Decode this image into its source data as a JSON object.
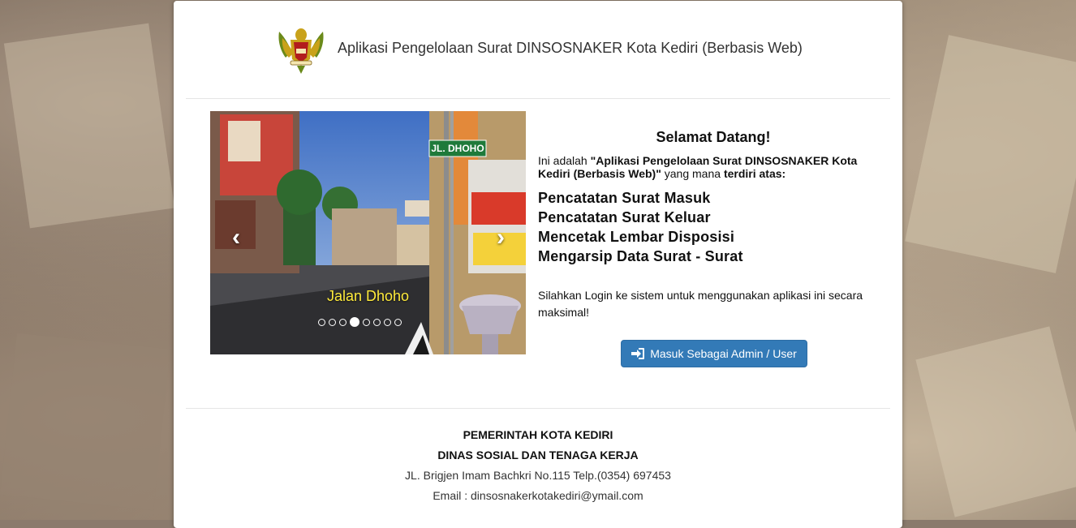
{
  "header": {
    "title": "Aplikasi Pengelolaan Surat DINSOSNAKER Kota Kediri (Berbasis Web)"
  },
  "carousel": {
    "sign_text": "JL. DHOHO",
    "caption": "Jalan Dhoho",
    "slide_count": 8,
    "active_index": 3,
    "prev_icon": "chevron-left-icon",
    "next_icon": "chevron-right-icon"
  },
  "welcome": {
    "heading": "Selamat Datang!",
    "intro_prefix": "Ini adalah ",
    "intro_app": "\"Aplikasi Pengelolaan Surat DINSOSNAKER Kota Kediri (Berbasis Web)\"",
    "intro_mid": " yang mana ",
    "intro_suffix": "terdiri atas:",
    "features": [
      "Pencatatan Surat Masuk",
      "Pencatatan Surat Keluar",
      "Mencetak Lembar Disposisi",
      "Mengarsip Data Surat - Surat"
    ],
    "login_text": "Silahkan Login ke sistem untuk menggunakan aplikasi ini secara maksimal!"
  },
  "login_button": {
    "label": "Masuk Sebagai Admin / User",
    "icon": "sign-in-icon",
    "color": "#337ab7"
  },
  "footer": {
    "line1": "PEMERINTAH KOTA KEDIRI",
    "line2": "DINAS SOSIAL DAN TENAGA KERJA",
    "address": "JL. Brigjen Imam Bachkri No.115 Telp.(0354) 697453",
    "email": "Email : dinsosnakerkotakediri@ymail.com"
  }
}
